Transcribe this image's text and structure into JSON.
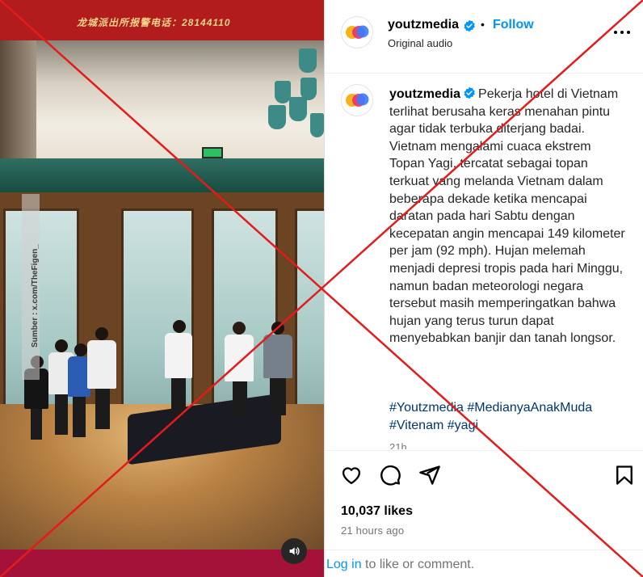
{
  "media": {
    "banner_text": "龙城派出所报警电话：28144110",
    "watermark": "Sumber : x.com/TheFigen_",
    "audio_icon": "speaker-icon"
  },
  "post": {
    "username": "youtzmedia",
    "verified_icon": "verified-badge-icon",
    "separator": "•",
    "follow_label": "Follow",
    "audio_label": "Original audio",
    "more_icon": "more-options-icon",
    "caption": "Pekerja hotel di Vietnam terlihat berusaha keras menahan pintu agar tidak terbuka diterjang badai. Vietnam mengalami cuaca ekstrem Topan Yagi, tercatat sebagai topan terkuat yang melanda Vietnam dalam beberapa dekade ketika mencapai daratan pada hari Sabtu dengan kecepatan angin mencapai 149 kilometer per jam (92 mph). Hujan melemah menjadi depresi tropis pada hari Minggu, namun badan meteorologi negara tersebut masih memperingatkan bahwa hujan yang terus turun dapat menyebabkan banjir dan tanah longsor.",
    "hashtags": [
      "#Youtzmedia",
      "#MedianyaAnakMuda",
      "#Vitenam",
      "#yagi"
    ],
    "caption_time": "21h",
    "likes": "10,037 likes",
    "time_ago": "21 hours ago",
    "login_link": "Log in",
    "login_rest": " to like or comment."
  },
  "colors": {
    "accent_blue": "#0095f6",
    "hashtag_blue": "#00376b",
    "overlay_red": "#e31b1b",
    "muted_text": "#737373"
  }
}
